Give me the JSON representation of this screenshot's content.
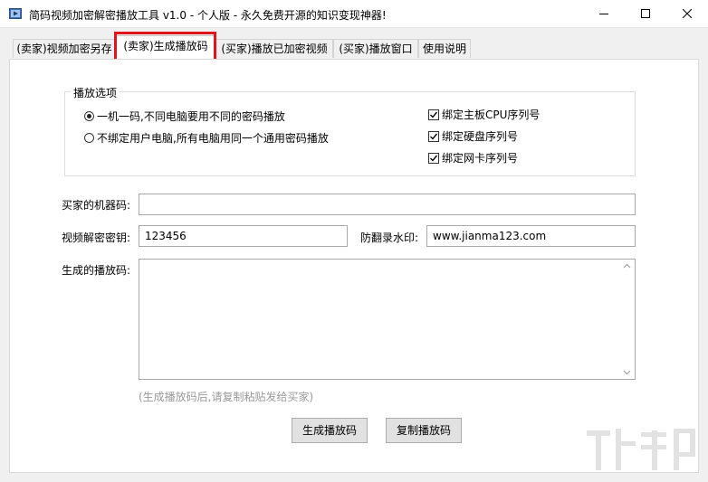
{
  "window": {
    "title": "简码视频加密解密播放工具 v1.0 - 个人版 - 永久免费开源的知识变现神器!",
    "icon": "film-app-icon",
    "controls": [
      "minimize-icon",
      "maximize-icon",
      "close-icon"
    ]
  },
  "tabs": [
    {
      "label": "(卖家)视频加密另存",
      "active": false
    },
    {
      "label": "(卖家)生成播放码",
      "active": true
    },
    {
      "label": "(买家)播放已加密视频",
      "active": false
    },
    {
      "label": "(买家)播放窗口",
      "active": false
    },
    {
      "label": "使用说明",
      "active": false
    }
  ],
  "playback_options": {
    "legend": "播放选项",
    "radios": [
      {
        "label": "一机一码,不同电脑要用不同的密码播放",
        "checked": true
      },
      {
        "label": "不绑定用户电脑,所有电脑用同一个通用密码播放",
        "checked": false
      }
    ],
    "checkboxes": [
      {
        "label": "绑定主板CPU序列号",
        "checked": true
      },
      {
        "label": "绑定硬盘序列号",
        "checked": true
      },
      {
        "label": "绑定网卡序列号",
        "checked": true
      }
    ]
  },
  "form": {
    "machine_code_label": "买家的机器码:",
    "machine_code_value": "",
    "decrypt_key_label": "视频解密密钥:",
    "decrypt_key_value": "123456",
    "watermark_label": "防翻录水印:",
    "watermark_value": "www.jianma123.com",
    "playcode_label": "生成的播放码:",
    "playcode_value": "",
    "hint": "(生成播放码后,请复制粘贴发给买家)"
  },
  "buttons": {
    "generate": "生成播放码",
    "copy": "复制播放码"
  },
  "colors": {
    "tab_highlight": "#e0141a",
    "window_bg": "#f0f0f0",
    "panel_bg": "#ffffff"
  }
}
